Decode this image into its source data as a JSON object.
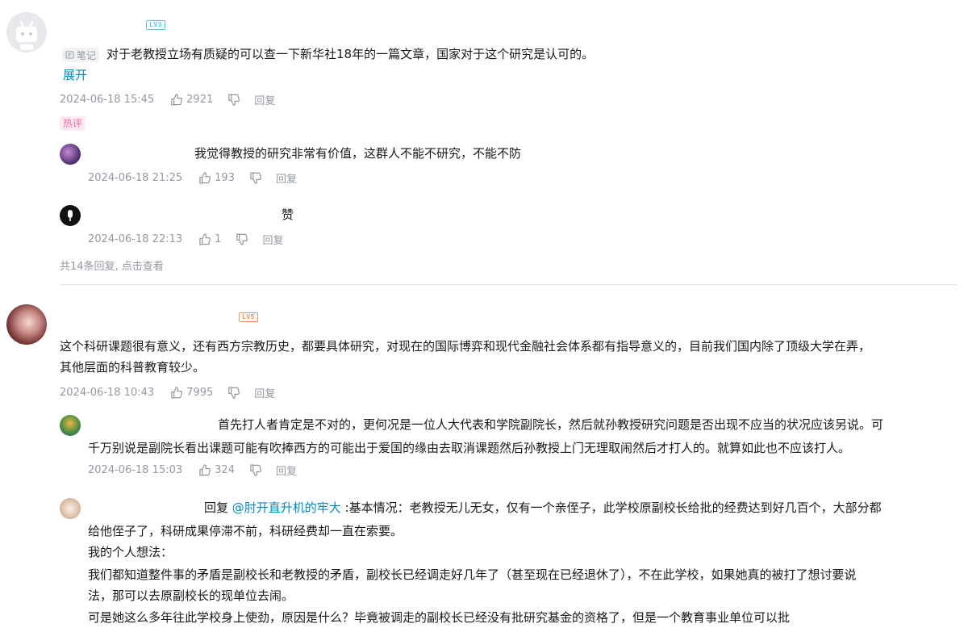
{
  "comment1": {
    "level": "LV3",
    "note_tag": "笔记",
    "text": "对于老教授立场有质疑的可以查一下新华社18年的一篇文章，国家对于这个研究是认可的。",
    "expand": "展开",
    "time": "2024-06-18 15:45",
    "likes": "2921",
    "reply": "回复",
    "hot_tag": "热评",
    "replies": [
      {
        "text": "我觉得教授的研究非常有价值，这群人不能不研究，不能不防",
        "time": "2024-06-18 21:25",
        "likes": "193",
        "reply": "回复"
      },
      {
        "text": "赞",
        "time": "2024-06-18 22:13",
        "likes": "1",
        "reply": "回复"
      }
    ],
    "more_replies": "共14条回复, 点击查看"
  },
  "comment2": {
    "level": "LV5",
    "text_line1": "这个科研课题很有意义，还有西方宗教历史，都要具体研究，对现在的国际博弈和现代金融社会体系都有指导意义的，目前我们国内除了顶级大学在弄，",
    "text_line2": "其他层面的科普教育较少。",
    "time": "2024-06-18 10:43",
    "likes": "7995",
    "reply": "回复",
    "replies": [
      {
        "line1": "首先打人者肯定是不对的，更何况是一位人大代表和学院副院长，然后就孙教授研究问题是否出现不应当的状况应该另说。可",
        "line2": "千万别说是副院长看出课题可能有吹捧西方的可能出于爱国的缘由去取消课题然后孙教授上门无理取闹然后才打人的。就算如此也不应该打人。",
        "time": "2024-06-18 15:03",
        "likes": "324",
        "reply": "回复"
      },
      {
        "reply_prefix": "回复 ",
        "mention": "@肘开直升机的牢大",
        "line1_rest": " :基本情况：老教授无儿无女，仅有一个亲侄子，此学校原副校长给批的经费达到好几百个，大部分都",
        "line2": "给他侄子了，科研成果停滞不前，科研经费却一直在索要。",
        "line3": "我的个人想法：",
        "line4": "我们都知道整件事的矛盾是副校长和老教授的矛盾，副校长已经调走好几年了（甚至现在已经退休了），不在此学校，如果她真的被打了想讨要说",
        "line5": "法，那可以去原副校长的现单位去闹。",
        "line6": "可是她这么多年往此学校身上使劲，原因是什么？毕竟被调走的副校长已经没有批研究基金的资格了，但是一个教育事业单位可以批"
      }
    ]
  },
  "colors": {
    "link": "#008ac5",
    "meta": "#9499a0",
    "hot": "#ff6699",
    "lv3": "#61c0f1",
    "lv5": "#ff8f4a"
  }
}
